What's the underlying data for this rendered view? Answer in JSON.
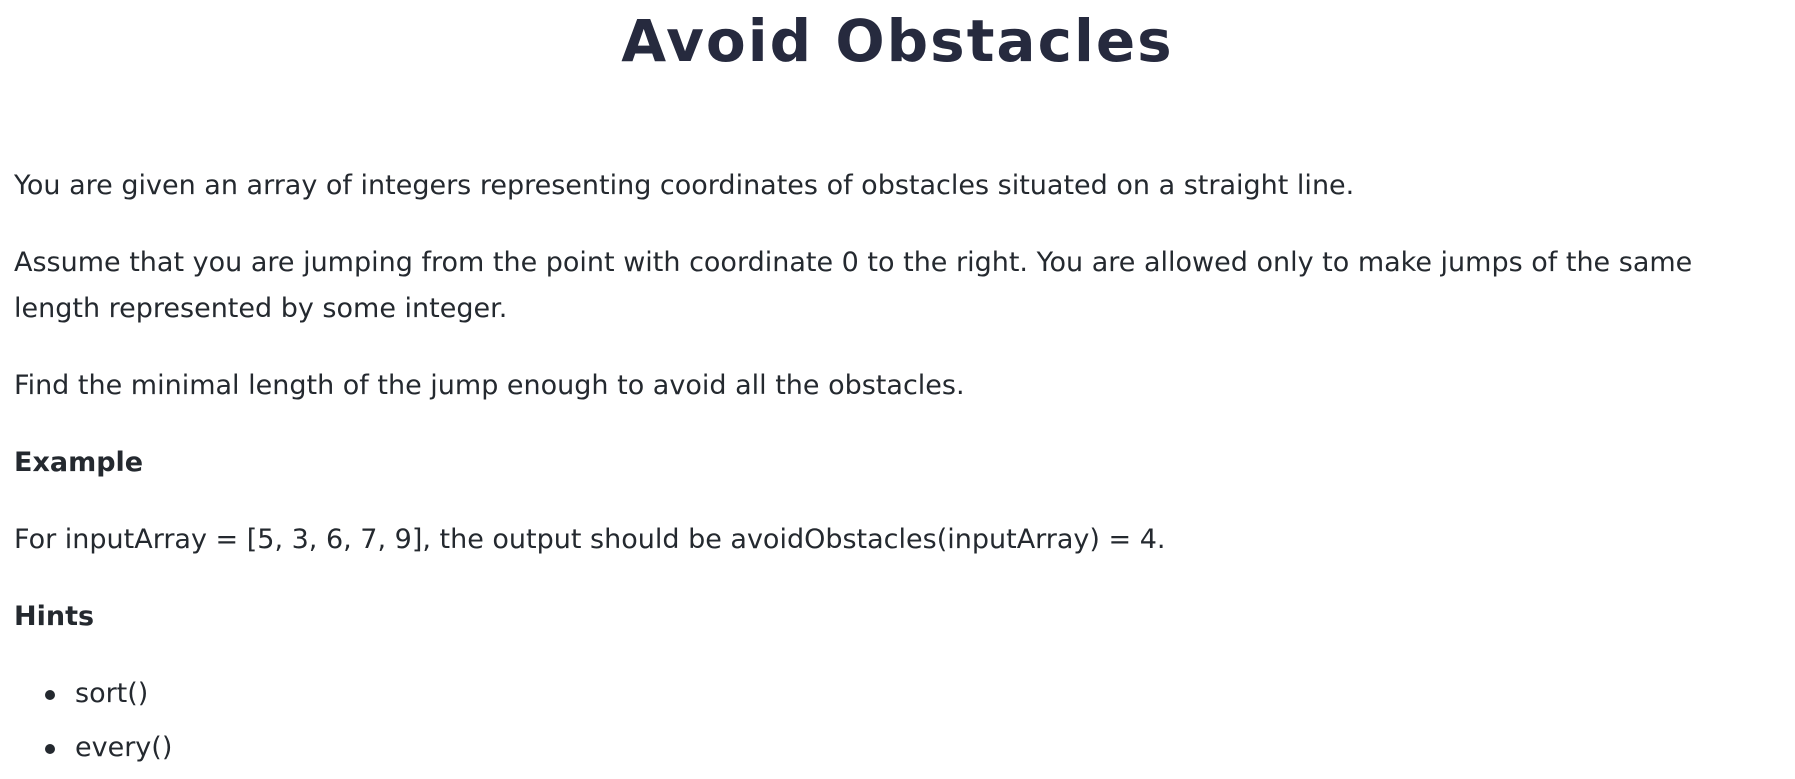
{
  "title": "Avoid Obstacles",
  "paragraphs": {
    "p1": "You are given an array of integers representing coordinates of obstacles situated on a straight line.",
    "p2": "Assume that you are jumping from the point with coordinate 0 to the right. You are allowed only to make jumps of the same length represented by some integer.",
    "p3": "Find the minimal length of the jump enough to avoid all the obstacles."
  },
  "example": {
    "heading": "Example",
    "text": "For inputArray = [5, 3, 6, 7, 9], the output should be avoidObstacles(inputArray) = 4."
  },
  "hints": {
    "heading": "Hints",
    "items": [
      "sort()",
      "every()"
    ]
  }
}
